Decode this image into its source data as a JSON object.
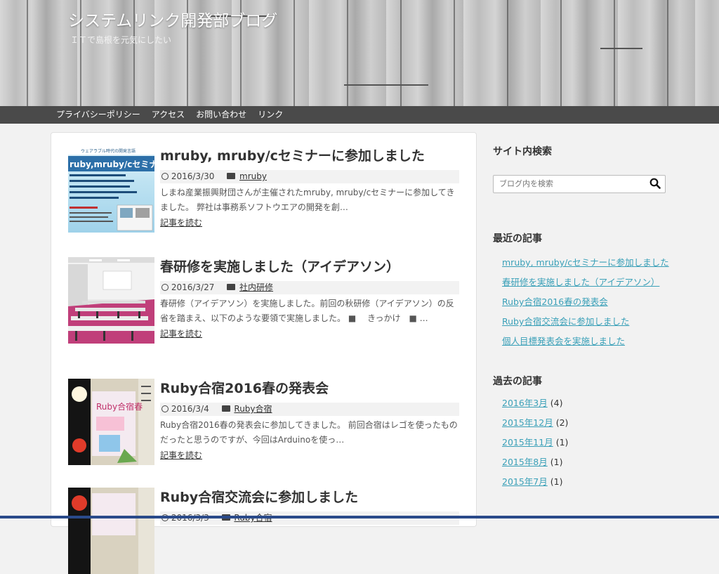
{
  "site": {
    "title": "システムリンク開発部ブログ",
    "tagline": "ＩＴで島根を元気にしたい"
  },
  "nav": {
    "items": [
      "プライバシーポリシー",
      "アクセス",
      "お問い合わせ",
      "リンク"
    ]
  },
  "posts": [
    {
      "title": "mruby, mruby/cセミナーに参加しました",
      "date": "2016/3/30",
      "category": "mruby",
      "excerpt": "しまね産業振興財団さんが主催されたmruby, mruby/cセミナーに参加してきました。 弊社は事務系ソフトウエアの開発を創…",
      "readmore": "記事を読む",
      "thumb_title": "ruby,mruby/cセミナ",
      "thumb_sub": "ウェアラブル時代の開発言語"
    },
    {
      "title": "春研修を実施しました（アイデアソン）",
      "date": "2016/3/27",
      "category": "社内研修",
      "excerpt": "春研修（アイデアソン）を実施しました。前回の秋研修（アイデアソン）の反省を踏まえ、以下のような要領で実施しました。 ■　 きっかけ　■ …",
      "readmore": "記事を読む"
    },
    {
      "title": "Ruby合宿2016春の発表会",
      "date": "2016/3/4",
      "category": "Ruby合宿",
      "excerpt": "Ruby合宿2016春の発表会に参加してきました。 前回合宿はレゴを使ったものだったと思うのですが、今回はArduinoを使っ…",
      "readmore": "記事を読む",
      "thumb_text": "Ruby合宿春"
    },
    {
      "title": "Ruby合宿交流会に参加しました",
      "date": "2016/3/3",
      "category": "Ruby合宿"
    }
  ],
  "sidebar": {
    "search_title": "サイト内検索",
    "search_placeholder": "ブログ内を検索",
    "recent_title": "最近の記事",
    "recent": [
      "mruby, mruby/cセミナーに参加しました",
      "春研修を実施しました（アイデアソン）",
      "Ruby合宿2016春の発表会",
      "Ruby合宿交流会に参加しました",
      "個人目標発表会を実施しました"
    ],
    "archive_title": "過去の記事",
    "archive": [
      {
        "label": "2016年3月",
        "count": "(4)"
      },
      {
        "label": "2015年12月",
        "count": "(2)"
      },
      {
        "label": "2015年11月",
        "count": "(1)"
      },
      {
        "label": "2015年8月",
        "count": "(1)"
      },
      {
        "label": "2015年7月",
        "count": "(1)"
      }
    ]
  },
  "colors": {
    "link": "#3aa0b8",
    "nav_bg": "#4a4a4a",
    "header_bg": "#c9c9c9"
  }
}
